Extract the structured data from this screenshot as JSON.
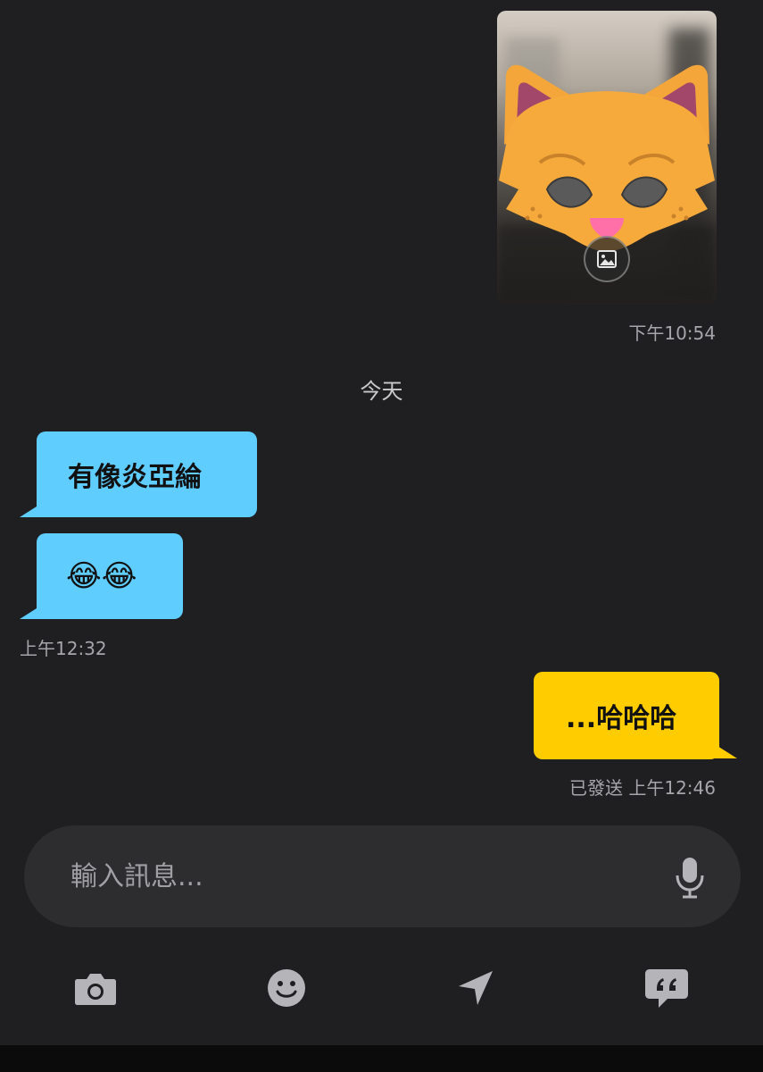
{
  "messages": {
    "photo_time": "下午10:54",
    "day_separator": "今天",
    "incoming": [
      {
        "text": "有像炎亞綸"
      },
      {
        "text": "😂😂"
      }
    ],
    "incoming_time": "上午12:32",
    "outgoing": {
      "text": "...哈哈哈"
    },
    "outgoing_status": "已發送 上午12:46"
  },
  "composer": {
    "placeholder": "輸入訊息..."
  },
  "icons": {
    "photo_badge": "image-icon",
    "mic": "microphone-icon",
    "toolbar": [
      "camera-icon",
      "emoji-icon",
      "location-arrow-icon",
      "quick-reply-icon"
    ]
  },
  "colors": {
    "background": "#1f1f21",
    "incoming_bubble": "#5fcdfe",
    "outgoing_bubble": "#ffcc00",
    "composer": "#2d2d30",
    "timestamp": "#a6a6aa"
  }
}
